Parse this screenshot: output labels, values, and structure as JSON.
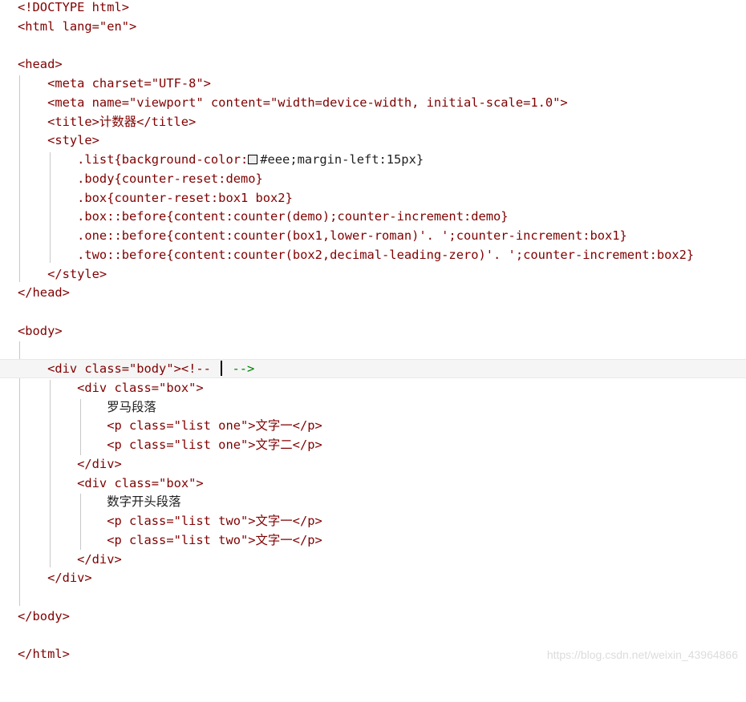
{
  "editor": {
    "lines": [
      [
        "<!DOCTYPE html>"
      ],
      [
        "<html lang=\"en\">"
      ],
      [
        ""
      ],
      [
        "<head>"
      ],
      [
        "    <meta charset=\"UTF-8\">"
      ],
      [
        "    <meta name=\"viewport\" content=\"width=device-width, initial-scale=1.0\">"
      ],
      [
        "    <title>计数器</title>"
      ],
      [
        "    <style>"
      ],
      [
        "        .list{background-color:",
        "#eee;margin-left:15px}"
      ],
      [
        "        .body{counter-reset:demo}"
      ],
      [
        "        .box{counter-reset:box1 box2}"
      ],
      [
        "        .box::before{content:counter(demo);counter-increment:demo}"
      ],
      [
        "        .one::before{content:counter(box1,lower-roman)'. ';counter-increment:box1}"
      ],
      [
        "        .two::before{content:counter(box2,decimal-leading-zero)'. ';counter-increment:box2}"
      ],
      [
        "    </style>"
      ],
      [
        "</head>"
      ],
      [
        ""
      ],
      [
        "<body>"
      ],
      [
        ""
      ],
      [
        "    <div class=\"body\"><!-- ",
        " -->"
      ],
      [
        "        <div class=\"box\">"
      ],
      [
        "            罗马段落"
      ],
      [
        "            <p class=\"list one\">文字一</p>"
      ],
      [
        "            <p class=\"list one\">文字二</p>"
      ],
      [
        "        </div>"
      ],
      [
        "        <div class=\"box\">"
      ],
      [
        "            数字开头段落"
      ],
      [
        "            <p class=\"list two\">文字一</p>"
      ],
      [
        "            <p class=\"list two\">文字一</p>"
      ],
      [
        "        </div>"
      ],
      [
        "    </div>"
      ],
      [
        ""
      ],
      [
        "</body>"
      ],
      [
        ""
      ],
      [
        "</html>"
      ]
    ],
    "current_line_index": 19
  },
  "watermark": "https://blog.csdn.net/weixin_43964866",
  "colors": {
    "background": "#ffffff",
    "tag": "#800000",
    "attribute": "#ff0000",
    "attribute_value": "#0000ff",
    "css_property": "#ff0000",
    "css_number": "#098658",
    "css_keyword": "#0451a5",
    "comment": "#008000",
    "indent_guide": "#c8c8c8",
    "current_line": "#f5f5f5"
  }
}
